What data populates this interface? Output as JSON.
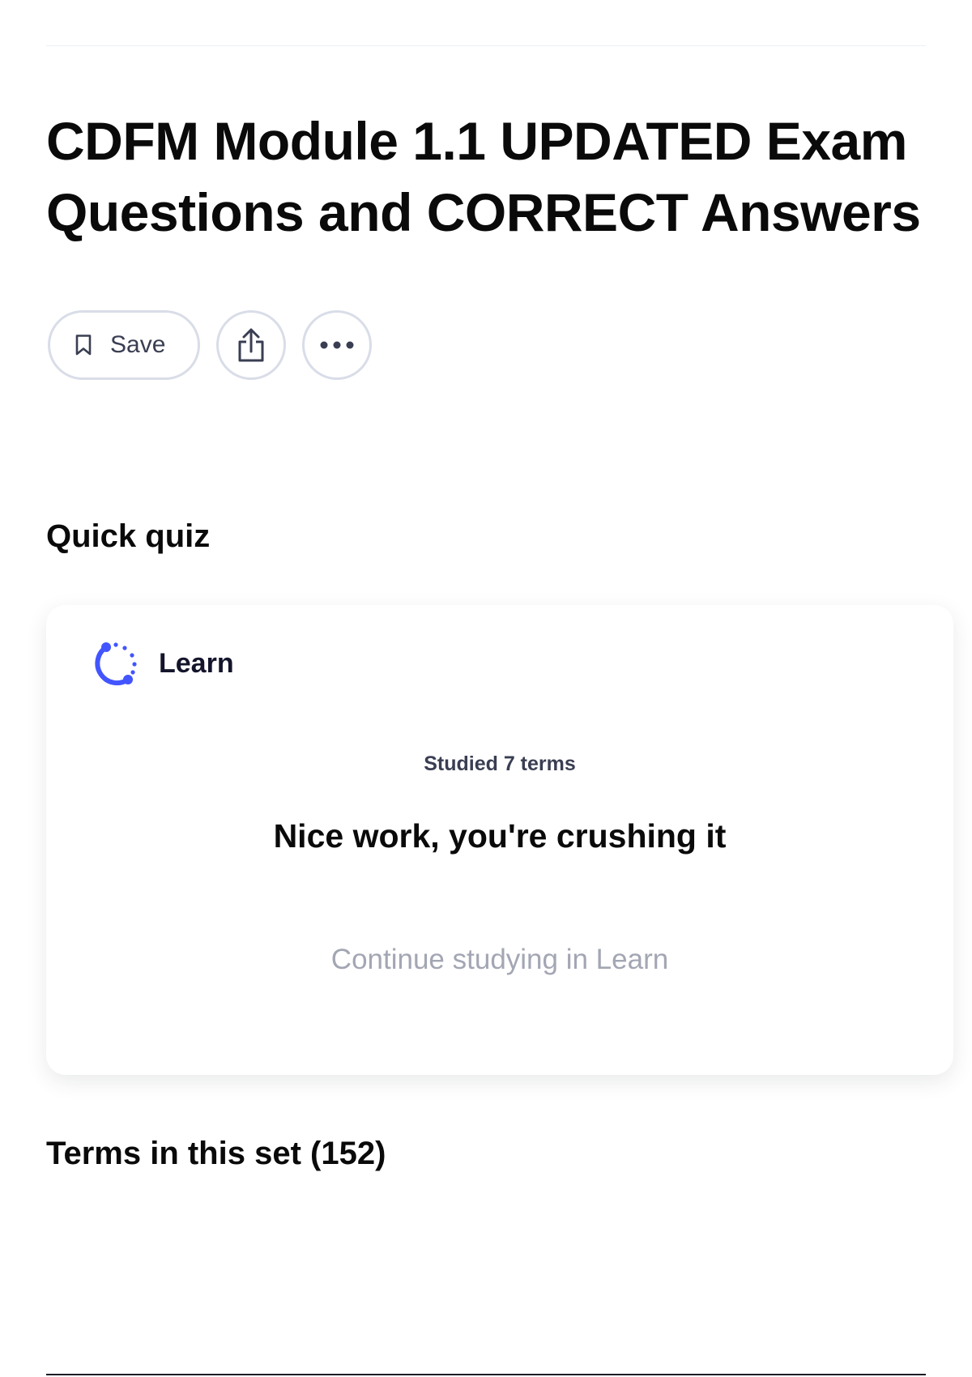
{
  "set": {
    "title": "CDFM Module 1.1 UPDATED Exam Questions and CORRECT Answers"
  },
  "actions": {
    "save_label": "Save",
    "share_icon": "share-icon",
    "more_icon": "more-options-icon"
  },
  "quick_quiz": {
    "heading": "Quick quiz",
    "mode_name": "Learn",
    "mode_icon": "learn-progress-icon",
    "studied_text": "Studied 7 terms",
    "message": "Nice work, you're crushing it",
    "continue_label": "Continue studying in Learn"
  },
  "terms": {
    "heading": "Terms in this set (152)"
  },
  "colors": {
    "accent": "#4255ff",
    "text": "#0a092d",
    "muted": "#a3a6b3",
    "border": "#d9dde8"
  }
}
